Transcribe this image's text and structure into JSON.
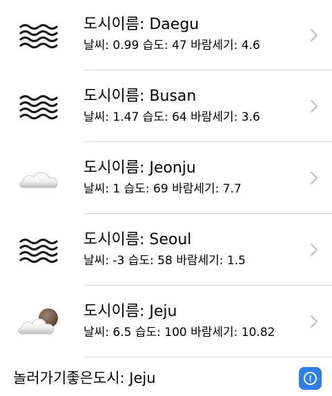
{
  "cities": [
    {
      "title": "도시이름: Daegu",
      "detail": "날씨: 0.99 습도: 47 바람세기: 4.6",
      "icon": "fog-icon"
    },
    {
      "title": "도시이름: Busan",
      "detail": "날씨: 1.47 습도: 64 바람세기: 3.6",
      "icon": "fog-icon"
    },
    {
      "title": "도시이름: Jeonju",
      "detail": "날씨: 1 습도: 69 바람세기: 7.7",
      "icon": "cloud-icon"
    },
    {
      "title": "도시이름: Seoul",
      "detail": "날씨: -3 습도: 58 바람세기: 1.5",
      "icon": "fog-icon"
    },
    {
      "title": "도시이름: Jeju",
      "detail": "날씨: 6.5 습도: 100 바람세기: 10.82",
      "icon": "partly-cloudy-night-icon"
    }
  ],
  "footer": {
    "label": "놀러가기좋은도시: Jeju",
    "info_glyph": "!"
  },
  "colors": {
    "accent": "#2f7ee6",
    "separator": "#dcdcdc",
    "chevron": "#c4c4c9"
  }
}
